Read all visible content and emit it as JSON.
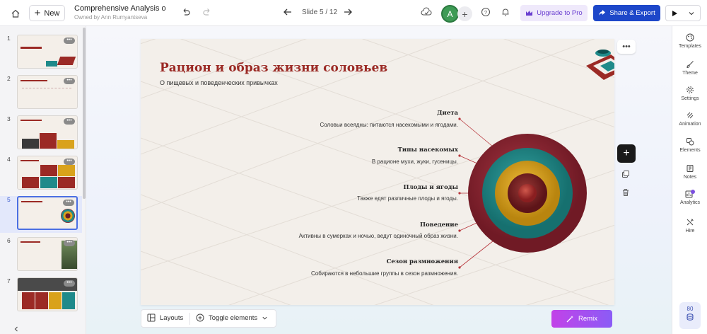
{
  "topbar": {
    "new_label": "New",
    "doc_title": "Comprehensive Analysis on ...",
    "owner": "Owned by Ann Rumyantseva",
    "slide_indicator": "Slide 5 / 12",
    "avatar_initial": "A",
    "upgrade_label": "Upgrade to Pro",
    "share_label": "Share & Export"
  },
  "thumbnails": [
    {
      "num": "1"
    },
    {
      "num": "2"
    },
    {
      "num": "3"
    },
    {
      "num": "4"
    },
    {
      "num": "5"
    },
    {
      "num": "6"
    },
    {
      "num": "7"
    }
  ],
  "slide": {
    "title": "Рацион и образ жизни соловьев",
    "subtitle": "О пищевых и поведенческих привычках",
    "items": [
      {
        "title": "Диета",
        "desc": "Соловьи всеядны: питаются насекомыми и ягодами."
      },
      {
        "title": "Типы насекомых",
        "desc": "В рационе мухи, жуки, гусеницы."
      },
      {
        "title": "Плоды и ягоды",
        "desc": "Также едят различные плоды и ягоды."
      },
      {
        "title": "Поведение",
        "desc": "Активны в сумерках и ночью, ведут одиночный образ жизни."
      },
      {
        "title": "Сезон размножения",
        "desc": "Собираются в небольшие группы в сезон размножения."
      }
    ],
    "colors": {
      "title": "#9b2a25",
      "ring_outer": "#8c2230",
      "ring_teal": "#1f8a8a",
      "ring_gold": "#d9a21b",
      "ring_inner": "#6e1d22"
    }
  },
  "bottom": {
    "layouts_label": "Layouts",
    "toggle_label": "Toggle elements",
    "remix_label": "Remix"
  },
  "rightpanel": {
    "items": [
      "Templates",
      "Theme",
      "Settings",
      "Animation",
      "Elements",
      "Notes",
      "Analytics",
      "Hire"
    ],
    "credits": "80"
  }
}
